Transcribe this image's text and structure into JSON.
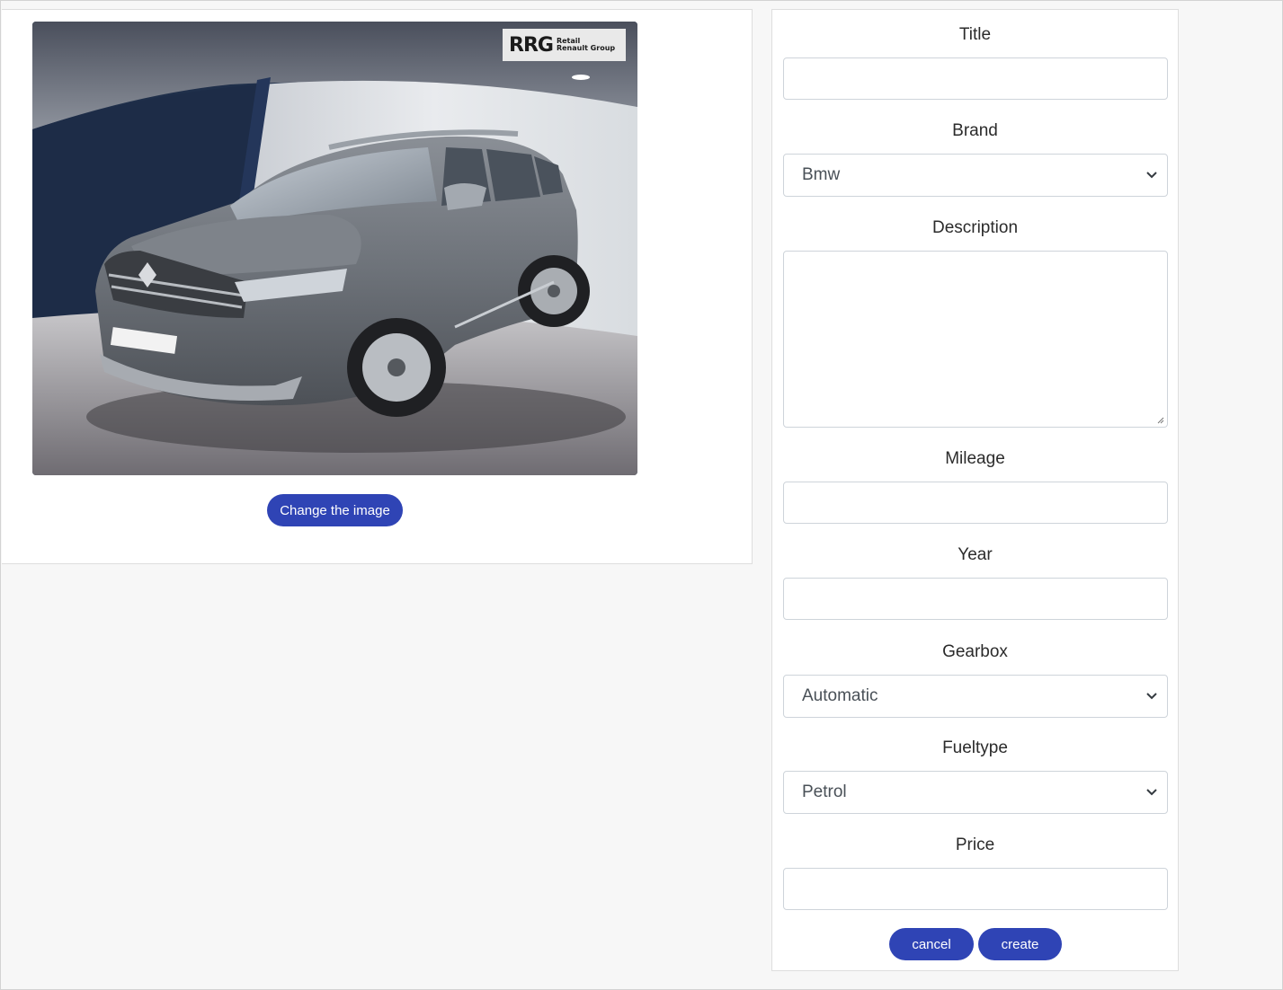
{
  "image_panel": {
    "logo": {
      "mark": "RRG",
      "line1": "Retail",
      "line2": "Renault Group"
    },
    "change_image_label": "Change the image"
  },
  "form": {
    "title": {
      "label": "Title",
      "value": ""
    },
    "brand": {
      "label": "Brand",
      "selected": "Bmw"
    },
    "description": {
      "label": "Description",
      "value": ""
    },
    "mileage": {
      "label": "Mileage",
      "value": ""
    },
    "year": {
      "label": "Year",
      "value": ""
    },
    "gearbox": {
      "label": "Gearbox",
      "selected": "Automatic"
    },
    "fueltype": {
      "label": "Fueltype",
      "selected": "Petrol"
    },
    "price": {
      "label": "Price",
      "value": ""
    },
    "cancel_label": "cancel",
    "create_label": "create"
  },
  "colors": {
    "accent": "#2f44b5",
    "page_bg": "#f7f7f7",
    "panel_bg": "#ffffff"
  }
}
